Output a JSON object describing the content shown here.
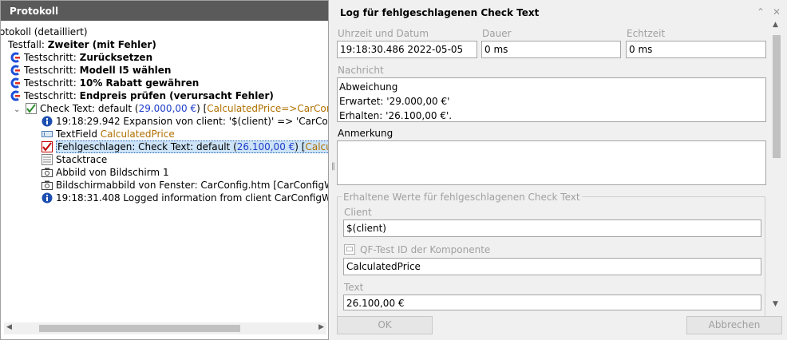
{
  "left": {
    "title": "Protokoll",
    "tree": [
      {
        "kind": "plain",
        "pre": "otokoll (detailliert)"
      },
      {
        "kind": "plain",
        "pre": "Testfall: ",
        "bold": "Zweiter (mit Fehler)"
      },
      {
        "kind": "step",
        "pre": "Testschritt: ",
        "bold": "Zurücksetzen"
      },
      {
        "kind": "step",
        "pre": "Testschritt: ",
        "bold": "Modell I5 wählen"
      },
      {
        "kind": "step",
        "pre": "Testschritt: ",
        "bold": "10% Rabatt gewähren"
      },
      {
        "kind": "step",
        "pre": "Testschritt: ",
        "bold": "Endpreis prüfen (verursacht Fehler)"
      },
      {
        "kind": "check",
        "pre": "Check Text: default (",
        "blue": "29.000,00 €",
        "mid": ") [",
        "gold": "CalculatedPrice=>CarConfig"
      },
      {
        "kind": "info",
        "pre": "19:18:29.942 Expansion von client: '$(client)' => 'CarConfig"
      },
      {
        "kind": "textfield",
        "pre": "TextField ",
        "gold": "CalculatedPrice"
      },
      {
        "kind": "fail",
        "pre": "Fehlgeschlagen: Check Text: default (",
        "blue": "26.100,00 €",
        "mid": ") [",
        "gold": "Calculate"
      },
      {
        "kind": "stack",
        "pre": "Stacktrace"
      },
      {
        "kind": "camera",
        "pre": "Abbild von Bildschirm 1"
      },
      {
        "kind": "camera",
        "pre": "Bildschirmabbild von Fenster: CarConfig.htm [CarConfigWe"
      },
      {
        "kind": "info",
        "pre": "19:18:31.408 Logged information from client CarConfigWe"
      }
    ]
  },
  "right": {
    "title": "Log für fehlgeschlagenen Check Text",
    "labels": {
      "time": "Uhrzeit und Datum",
      "duration": "Dauer",
      "realtime": "Echtzeit",
      "message": "Nachricht",
      "comment": "Anmerkung",
      "group": "Erhaltene Werte für fehlgeschlagenen Check Text",
      "client": "Client",
      "componentId": "QF-Test ID der Komponente",
      "text": "Text"
    },
    "values": {
      "time": "19:18:30.486  2022-05-05",
      "duration": "0 ms",
      "realtime": "0 ms",
      "message_lines": [
        "Abweichung",
        "Erwartet: '29.000,00 €'",
        "Erhalten: '26.100,00 €'."
      ],
      "comment": "",
      "client": "$(client)",
      "componentId": "CalculatedPrice",
      "text": "26.100,00 €"
    },
    "buttons": {
      "ok": "OK",
      "cancel": "Abbrechen"
    }
  }
}
